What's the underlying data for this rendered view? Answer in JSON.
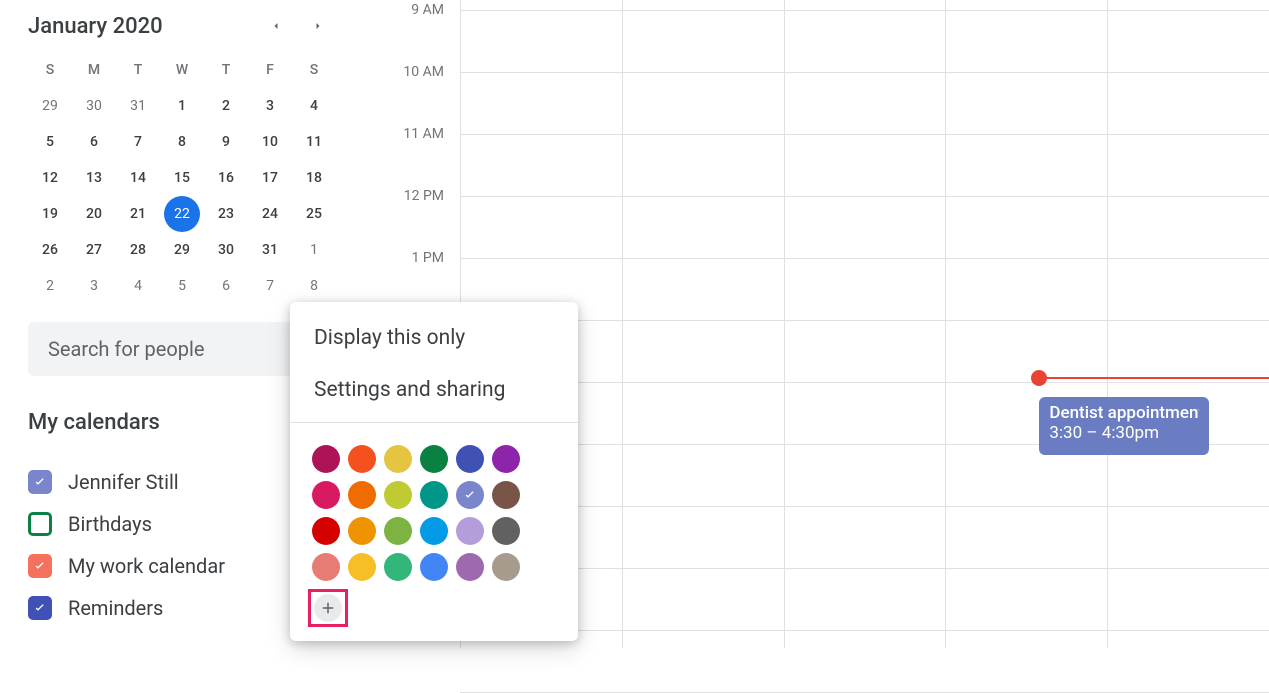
{
  "month": {
    "title": "January 2020",
    "dow": [
      "S",
      "M",
      "T",
      "W",
      "T",
      "F",
      "S"
    ],
    "weeks": [
      [
        {
          "d": "29",
          "o": true
        },
        {
          "d": "30",
          "o": true
        },
        {
          "d": "31",
          "o": true
        },
        {
          "d": "1"
        },
        {
          "d": "2"
        },
        {
          "d": "3"
        },
        {
          "d": "4"
        }
      ],
      [
        {
          "d": "5"
        },
        {
          "d": "6"
        },
        {
          "d": "7"
        },
        {
          "d": "8"
        },
        {
          "d": "9"
        },
        {
          "d": "10"
        },
        {
          "d": "11"
        }
      ],
      [
        {
          "d": "12"
        },
        {
          "d": "13"
        },
        {
          "d": "14"
        },
        {
          "d": "15"
        },
        {
          "d": "16"
        },
        {
          "d": "17"
        },
        {
          "d": "18"
        }
      ],
      [
        {
          "d": "19"
        },
        {
          "d": "20"
        },
        {
          "d": "21"
        },
        {
          "d": "22",
          "today": true
        },
        {
          "d": "23"
        },
        {
          "d": "24"
        },
        {
          "d": "25"
        }
      ],
      [
        {
          "d": "26"
        },
        {
          "d": "27"
        },
        {
          "d": "28"
        },
        {
          "d": "29"
        },
        {
          "d": "30"
        },
        {
          "d": "31"
        },
        {
          "d": "1",
          "o": true
        }
      ],
      [
        {
          "d": "2",
          "o": true
        },
        {
          "d": "3",
          "o": true
        },
        {
          "d": "4",
          "o": true
        },
        {
          "d": "5",
          "o": true
        },
        {
          "d": "6",
          "o": true
        },
        {
          "d": "7",
          "o": true
        },
        {
          "d": "8",
          "o": true
        }
      ]
    ]
  },
  "search": {
    "placeholder": "Search for people"
  },
  "mycal_header": "My calendars",
  "calendars": [
    {
      "label": "Jennifer Still",
      "color": "#7986cb",
      "checked": true
    },
    {
      "label": "Birthdays",
      "color": "#0b8043",
      "checked": false
    },
    {
      "label": "My work calendar",
      "color": "#f4725d",
      "checked": true
    },
    {
      "label": "Reminders",
      "color": "#3f51b5",
      "checked": true
    }
  ],
  "context": {
    "display_only": "Display this only",
    "settings": "Settings and sharing",
    "colors": [
      "#ad1457",
      "#f4511e",
      "#e4c441",
      "#0b8043",
      "#3f51b5",
      "#8e24aa",
      "#d81b60",
      "#ef6c00",
      "#c0ca33",
      "#009688",
      "#7986cb",
      "#795548",
      "#d50000",
      "#f09300",
      "#7cb342",
      "#039be5",
      "#b39ddb",
      "#616161",
      "#e67c73",
      "#f6bf26",
      "#33b679",
      "#4285f4",
      "#9e69af",
      "#a79b8e"
    ],
    "selected_color_index": 10
  },
  "grid": {
    "time_labels": [
      "9 AM",
      "10 AM",
      "11 AM",
      "12 PM",
      "1 PM"
    ],
    "event": {
      "title": "Dentist appointment",
      "time": "3:30 – 4:30pm"
    }
  }
}
